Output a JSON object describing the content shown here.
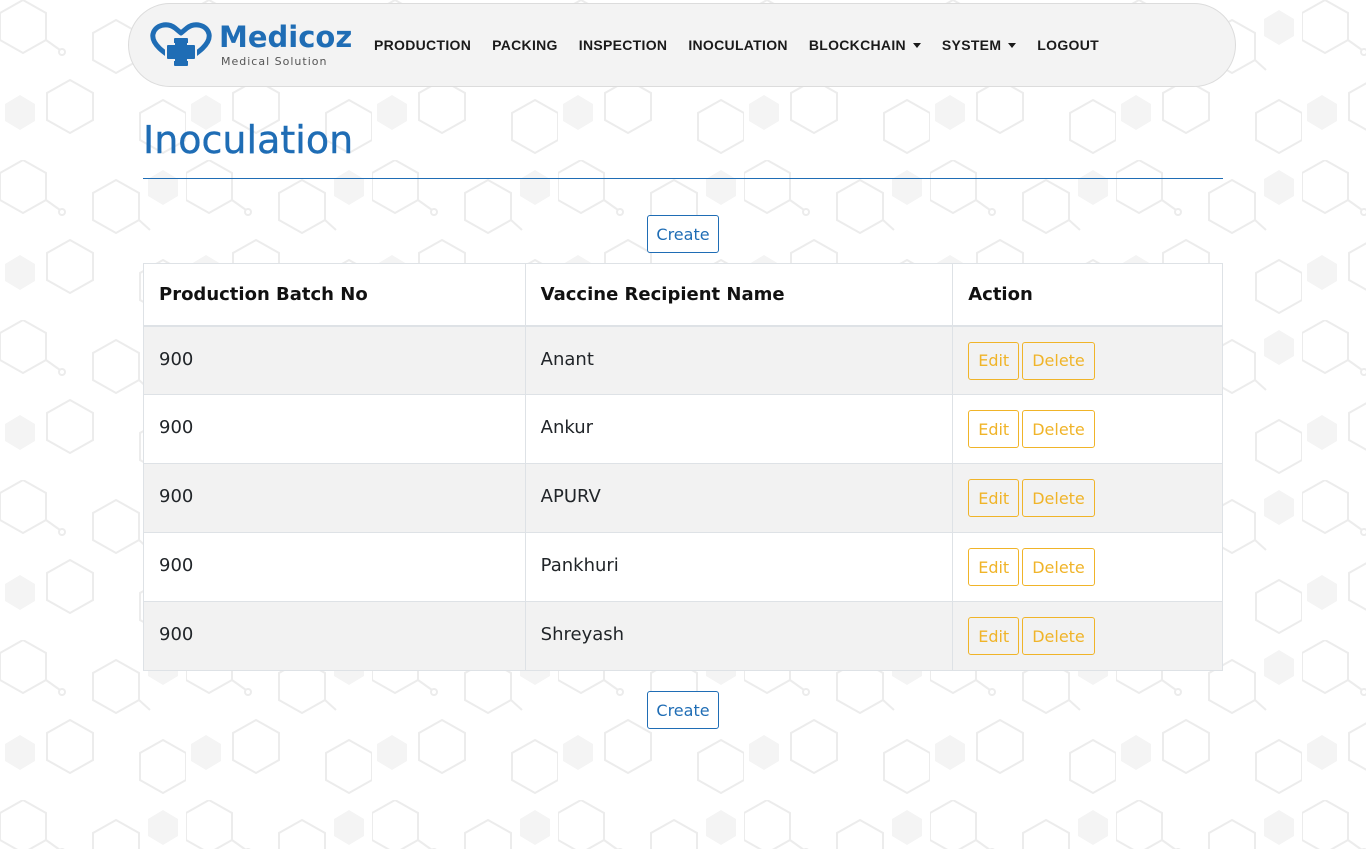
{
  "brand": {
    "name": "Medicoz",
    "tagline": "Medical Solution"
  },
  "nav": {
    "items": [
      {
        "label": "PRODUCTION",
        "dropdown": false
      },
      {
        "label": "PACKING",
        "dropdown": false
      },
      {
        "label": "INSPECTION",
        "dropdown": false
      },
      {
        "label": "INOCULATION",
        "dropdown": false
      },
      {
        "label": "BLOCKCHAIN",
        "dropdown": true
      },
      {
        "label": "SYSTEM",
        "dropdown": true
      },
      {
        "label": "LOGOUT",
        "dropdown": false
      }
    ]
  },
  "page": {
    "title": "Inoculation",
    "create_label": "Create"
  },
  "table": {
    "headers": [
      "Production Batch No",
      "Vaccine Recipient Name",
      "Action"
    ],
    "edit_label": "Edit",
    "delete_label": "Delete",
    "rows": [
      {
        "batch": "900",
        "name": "Anant"
      },
      {
        "batch": "900",
        "name": "Ankur"
      },
      {
        "batch": "900",
        "name": "APURV"
      },
      {
        "batch": "900",
        "name": "Pankhuri"
      },
      {
        "batch": "900",
        "name": "Shreyash"
      }
    ]
  },
  "colors": {
    "primary": "#1f6db5",
    "warning": "#f0b429",
    "navbar_bg": "#f3f3f3",
    "row_stripe": "#f2f2f2"
  }
}
